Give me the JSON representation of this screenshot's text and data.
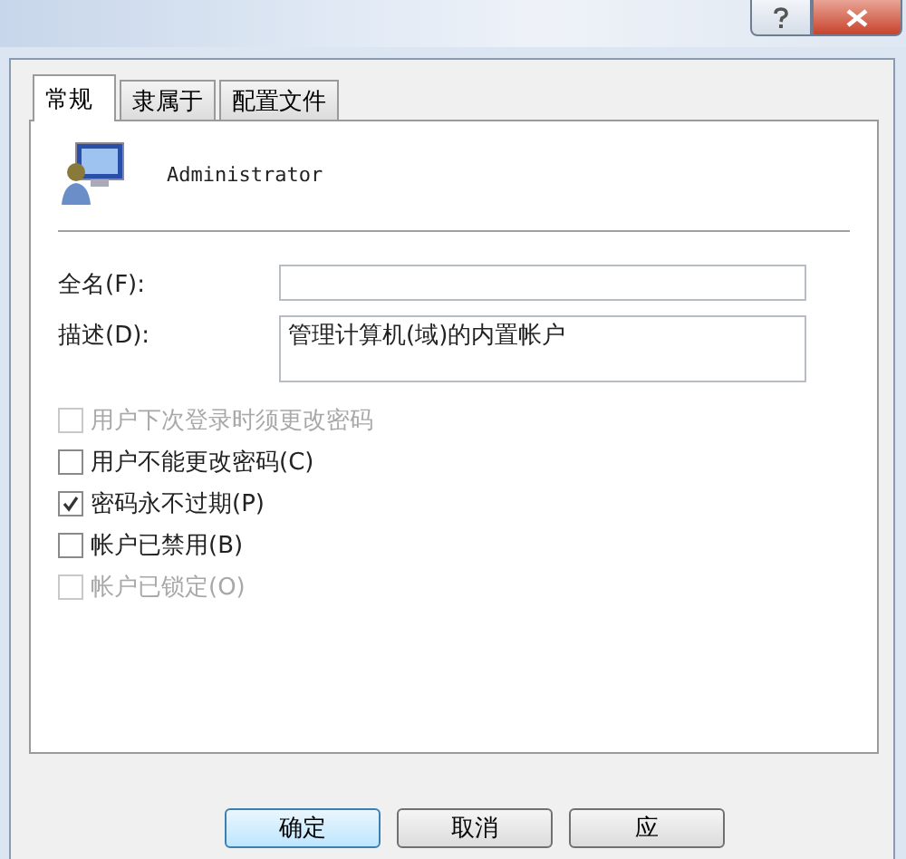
{
  "tabs": [
    {
      "label": "常规",
      "selected": true
    },
    {
      "label": "隶属于",
      "selected": false
    },
    {
      "label": "配置文件",
      "selected": false
    }
  ],
  "user": {
    "name": "Administrator"
  },
  "fields": [
    {
      "label": "全名(F):"
    },
    {
      "label": "描述(D):",
      "value": "管理计算机(域)的内置帐户"
    }
  ],
  "options": [
    {
      "label": "用户下次登录时须更改密码",
      "checked": false,
      "disabled": true
    },
    {
      "label": "用户不能更改密码(C)",
      "checked": false,
      "disabled": false
    },
    {
      "label": "密码永不过期(P)",
      "checked": true,
      "disabled": false
    },
    {
      "label": "帐户已禁用(B)",
      "checked": false,
      "disabled": false
    },
    {
      "label": "帐户已锁定(O)",
      "checked": false,
      "disabled": true
    }
  ],
  "buttons": [
    {
      "label": "确定",
      "kind": "default"
    },
    {
      "label": "取消",
      "kind": "normal"
    },
    {
      "label": "应",
      "kind": "normal"
    }
  ]
}
